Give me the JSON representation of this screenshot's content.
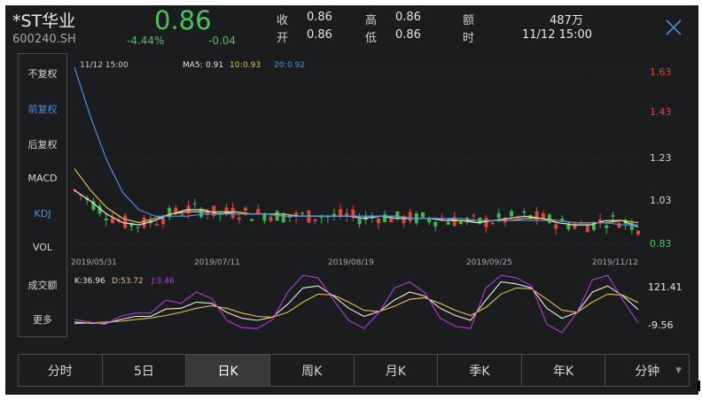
{
  "header": {
    "name": "*ST华业",
    "code": "600240.SH",
    "price": "0.86",
    "change_pct": "-4.44%",
    "change": "-0.04",
    "quote": [
      {
        "label": "收",
        "value": "0.86"
      },
      {
        "label": "开",
        "value": "0.86"
      },
      {
        "label": "高",
        "value": "0.86"
      },
      {
        "label": "低",
        "value": "0.86"
      },
      {
        "label": "额",
        "value": "487万"
      },
      {
        "label": "时",
        "value": "11/12 15:00"
      }
    ]
  },
  "sidebar": {
    "items": [
      "不复权",
      "前复权",
      "后复权",
      "MACD",
      "KDJ",
      "VOL",
      "成交额",
      "更多"
    ],
    "active": [
      "前复权",
      "KDJ"
    ]
  },
  "chart": {
    "info": {
      "time": "11/12 15:00",
      "ma5_label": "MA5:",
      "ma5_value": "0.91",
      "ma10_label": "10:",
      "ma10_value": "0.93",
      "ma20_label": "20:",
      "ma20_value": "0.92"
    },
    "price_axis": [
      "1.63",
      "1.43",
      "1.23",
      "1.03",
      "0.83"
    ],
    "date_axis": [
      "2019/05/31",
      "2019/07/11",
      "2019/08/19",
      "2019/09/25",
      "2019/11/12"
    ],
    "kdj": {
      "k_label": "K:36.96",
      "d_label": "D:53.72",
      "j_label": "J:3.46",
      "max": "121.41",
      "min": "-9.56"
    }
  },
  "tabs": [
    "分时",
    "5日",
    "日K",
    "周K",
    "月K",
    "季K",
    "年K",
    "分钟"
  ],
  "active_tab": "日K",
  "colors": {
    "bg": "#1b1c1e",
    "up": "#e0443b",
    "down": "#3fb64e",
    "ma5": "#eae9e4",
    "ma10": "#e6c14a",
    "ma20": "#4a90e2",
    "j_line": "#b03cdc",
    "accent": "#4a90e2"
  },
  "chart_data": [
    {
      "type": "line",
      "title": "",
      "series": [
        {
          "name": "MA5",
          "values": [
            1.08,
            1.03,
            0.97,
            0.93,
            0.92,
            0.94,
            0.97,
            0.99,
            0.99,
            0.97,
            0.98,
            0.97,
            0.97,
            0.96,
            0.96,
            0.96,
            0.96,
            0.96,
            0.95,
            0.96,
            0.95,
            0.95,
            0.95,
            0.94,
            0.94,
            0.93,
            0.94,
            0.95,
            0.96,
            0.95,
            0.93,
            0.92,
            0.92,
            0.94,
            0.94,
            0.91
          ]
        },
        {
          "name": "10",
          "values": [
            1.18,
            1.08,
            1.0,
            0.95,
            0.93,
            0.95,
            0.97,
            0.98,
            0.98,
            0.98,
            0.98,
            0.97,
            0.97,
            0.97,
            0.96,
            0.96,
            0.96,
            0.96,
            0.96,
            0.96,
            0.96,
            0.95,
            0.95,
            0.95,
            0.94,
            0.94,
            0.94,
            0.94,
            0.95,
            0.95,
            0.94,
            0.93,
            0.93,
            0.93,
            0.94,
            0.93
          ]
        },
        {
          "name": "20",
          "values": [
            1.65,
            1.42,
            1.22,
            1.07,
            0.99,
            0.96,
            0.96,
            0.96,
            0.97,
            0.97,
            0.97,
            0.97,
            0.97,
            0.96,
            0.96,
            0.96,
            0.96,
            0.96,
            0.96,
            0.96,
            0.96,
            0.95,
            0.95,
            0.95,
            0.95,
            0.94,
            0.94,
            0.94,
            0.94,
            0.94,
            0.94,
            0.93,
            0.93,
            0.93,
            0.92,
            0.92
          ]
        }
      ],
      "ylim": [
        0.83,
        1.63
      ],
      "xlabel": "",
      "ylabel": ""
    },
    {
      "type": "line",
      "title": "",
      "series": [
        {
          "name": "K",
          "values": [
            6,
            3,
            2,
            12,
            20,
            20,
            38,
            40,
            55,
            52,
            30,
            15,
            10,
            18,
            50,
            90,
            95,
            70,
            40,
            20,
            32,
            60,
            80,
            70,
            40,
            22,
            10,
            60,
            105,
            100,
            90,
            40,
            15,
            30,
            80,
            95,
            70,
            36.96
          ]
        },
        {
          "name": "D",
          "values": [
            2,
            4,
            6,
            8,
            12,
            16,
            22,
            30,
            40,
            46,
            40,
            28,
            20,
            18,
            30,
            55,
            75,
            72,
            55,
            35,
            32,
            45,
            62,
            66,
            52,
            35,
            22,
            42,
            75,
            90,
            88,
            62,
            35,
            30,
            55,
            75,
            72,
            53.72
          ]
        },
        {
          "name": "J",
          "values": [
            12,
            6,
            0,
            20,
            28,
            28,
            60,
            52,
            80,
            64,
            10,
            -8,
            -10,
            12,
            80,
            121,
            115,
            60,
            10,
            -10,
            30,
            90,
            105,
            78,
            16,
            -5,
            -10,
            90,
            121,
            115,
            95,
            0,
            -20,
            30,
            110,
            121,
            60,
            3.46
          ]
        }
      ],
      "ylim": [
        -9.56,
        121.41
      ],
      "xlabel": "",
      "ylabel": ""
    }
  ]
}
